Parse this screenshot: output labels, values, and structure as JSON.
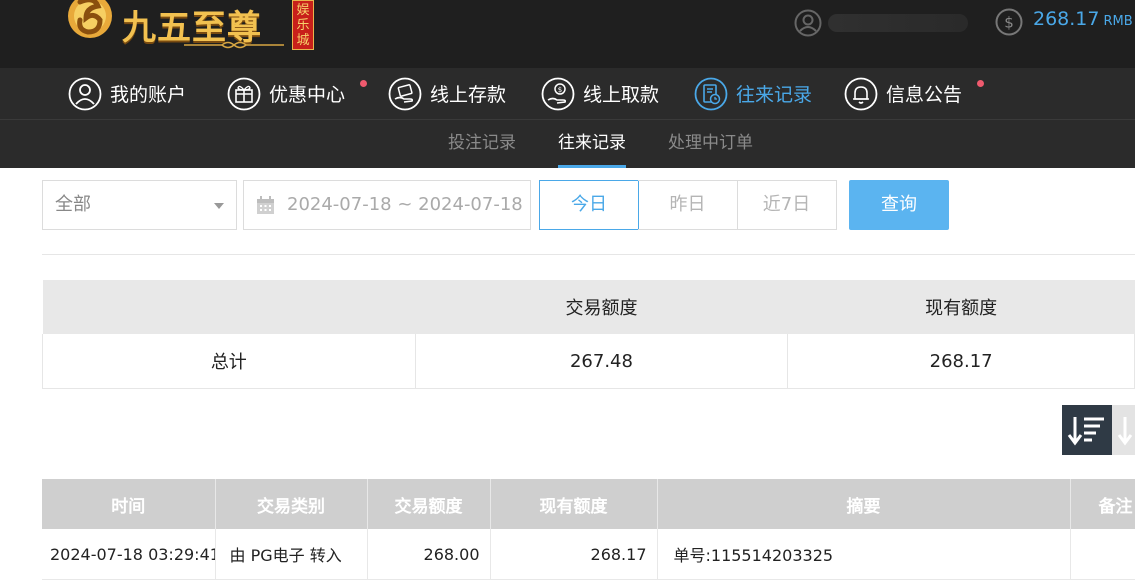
{
  "header": {
    "logo_text": "九五至尊",
    "logo_badge": "娱乐城",
    "balance_value": "268.17",
    "balance_unit": "RMB"
  },
  "nav": {
    "items": [
      {
        "label": "我的账户",
        "icon": "user-circle-icon"
      },
      {
        "label": "优惠中心",
        "icon": "gift-icon",
        "badge": true
      },
      {
        "label": "线上存款",
        "icon": "deposit-hand-icon"
      },
      {
        "label": "线上取款",
        "icon": "withdraw-hand-icon"
      },
      {
        "label": "往来记录",
        "icon": "record-document-icon",
        "active": true
      },
      {
        "label": "信息公告",
        "icon": "bell-icon",
        "badge": true
      }
    ]
  },
  "subnav": {
    "items": [
      {
        "label": "投注记录"
      },
      {
        "label": "往来记录",
        "active": true
      },
      {
        "label": "处理中订单"
      }
    ]
  },
  "filter": {
    "type_selected": "全部",
    "date_range": "2024-07-18 ~ 2024-07-18",
    "quick_ranges": [
      "今日",
      "昨日",
      "近7日"
    ],
    "active_range": "今日",
    "query_label": "查询"
  },
  "summary": {
    "headers": [
      "",
      "交易额度",
      "现有额度"
    ],
    "row_label": "总计",
    "trade_total": "267.48",
    "current_total": "268.17"
  },
  "records": {
    "headers": [
      "时间",
      "交易类别",
      "交易额度",
      "现有额度",
      "摘要",
      "备注"
    ],
    "rows": [
      {
        "time": "2024-07-18 03:29:41",
        "type": "由 PG电子 转入",
        "amount": "268.00",
        "balance": "268.17",
        "summary": "单号:115514203325",
        "note": ""
      }
    ]
  },
  "colors": {
    "accent": "#4aa8e8",
    "badge_dot": "#ef5a6e",
    "header_bg": "#1f1f1f",
    "nav_bg": "#2b2b2b"
  }
}
